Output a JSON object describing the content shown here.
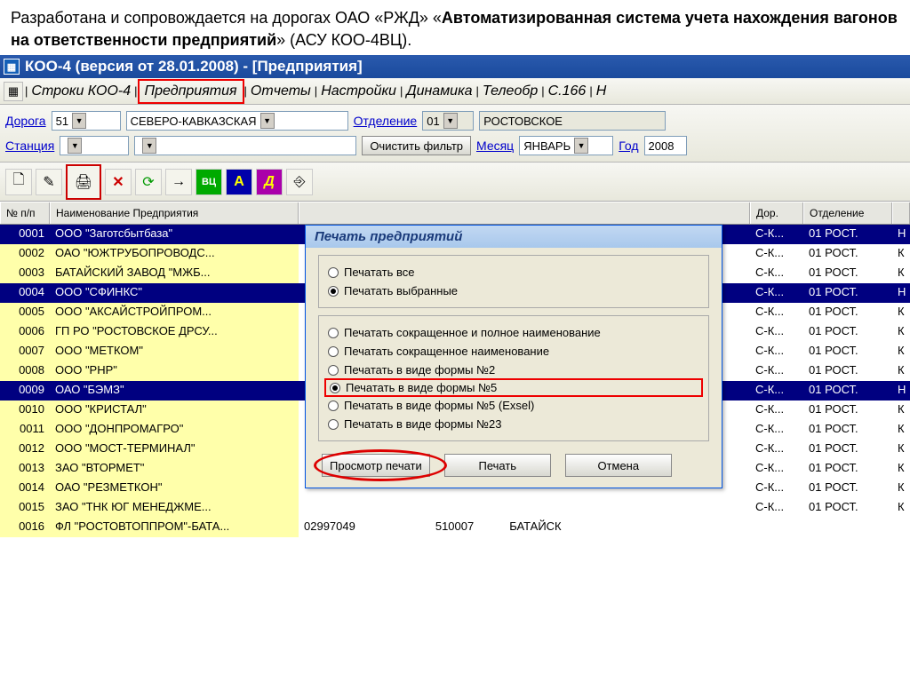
{
  "caption": {
    "pre": "Разработана и сопровождается на дорогах ОАО «РЖД» «",
    "bold": "Автоматизированная система учета нахождения вагонов на ответственности предприятий",
    "post": "» (АСУ КОО-4ВЦ)."
  },
  "window": {
    "title": "КОО-4 (версия от 28.01.2008) - [Предприятия]"
  },
  "menu": {
    "items": [
      "Строки КОО-4",
      "Предприятия",
      "Отчеты",
      "Настройки",
      "Динамика",
      "Телеобр",
      "С.166",
      "Н"
    ]
  },
  "filter": {
    "road_label": "Дорога",
    "road_code": "51",
    "road_name": "СЕВЕРО-КАВКАЗСКАЯ",
    "dept_label": "Отделение",
    "dept_code": "01",
    "dept_name": "РОСТОВСКОЕ",
    "station_label": "Станция",
    "clear_btn": "Очистить фильтр",
    "month_label": "Месяц",
    "month_val": "ЯНВАРЬ",
    "year_label": "Год",
    "year_val": "2008"
  },
  "grid": {
    "headers": {
      "id": "№ п/п",
      "name": "Наименование Предприятия",
      "dor": "Дор.",
      "dep": "Отделение"
    },
    "rows": [
      {
        "id": "0001",
        "name": "ООО \"Заготсбытбаза\"",
        "dor": "С-К...",
        "dep": "01 РОСТ.",
        "sel": true,
        "end": "Н"
      },
      {
        "id": "0002",
        "name": "ОАО \"ЮЖТРУБОПРОВОДС...",
        "dor": "С-К...",
        "dep": "01 РОСТ.",
        "sel": false,
        "end": "К"
      },
      {
        "id": "0003",
        "name": "БАТАЙСКИЙ ЗАВОД \"МЖБ...",
        "dor": "С-К...",
        "dep": "01 РОСТ.",
        "sel": false,
        "end": "К"
      },
      {
        "id": "0004",
        "name": "ООО \"СФИНКС\"",
        "dor": "С-К...",
        "dep": "01 РОСТ.",
        "sel": true,
        "end": "Н"
      },
      {
        "id": "0005",
        "name": "ООО \"АКСАЙСТРОЙПРОМ...",
        "dor": "С-К...",
        "dep": "01 РОСТ.",
        "sel": false,
        "end": "К"
      },
      {
        "id": "0006",
        "name": "ГП РО \"РОСТОВСКОЕ ДРСУ...",
        "dor": "С-К...",
        "dep": "01 РОСТ.",
        "sel": false,
        "end": "К"
      },
      {
        "id": "0007",
        "name": "ООО \"МЕТКОМ\"",
        "dor": "С-К...",
        "dep": "01 РОСТ.",
        "sel": false,
        "end": "К"
      },
      {
        "id": "0008",
        "name": "ООО \"РНР\"",
        "dor": "С-К...",
        "dep": "01 РОСТ.",
        "sel": false,
        "end": "К"
      },
      {
        "id": "0009",
        "name": "ОАО \"БЭМЗ\"",
        "dor": "С-К...",
        "dep": "01 РОСТ.",
        "sel": true,
        "end": "Н"
      },
      {
        "id": "0010",
        "name": "ООО \"КРИСТАЛ\"",
        "dor": "С-К...",
        "dep": "01 РОСТ.",
        "sel": false,
        "end": "К"
      },
      {
        "id": "0011",
        "name": "ООО \"ДОНПРОМАГРО\"",
        "dor": "С-К...",
        "dep": "01 РОСТ.",
        "sel": false,
        "end": "К"
      },
      {
        "id": "0012",
        "name": "ООО \"МОСТ-ТЕРМИНАЛ\"",
        "dor": "С-К...",
        "dep": "01 РОСТ.",
        "sel": false,
        "end": "К"
      },
      {
        "id": "0013",
        "name": "ЗАО \"ВТОРМЕТ\"",
        "dor": "С-К...",
        "dep": "01 РОСТ.",
        "sel": false,
        "end": "К"
      },
      {
        "id": "0014",
        "name": "ОАО \"РЕЗМЕТКОН\"",
        "dor": "С-К...",
        "dep": "01 РОСТ.",
        "sel": false,
        "end": "К"
      },
      {
        "id": "0015",
        "name": "ЗАО \"ТНК ЮГ МЕНЕДЖМЕ...",
        "dor": "С-К...",
        "dep": "01 РОСТ.",
        "sel": false,
        "end": "К"
      },
      {
        "id": "0016",
        "name": "ФЛ \"РОСТОВТОППРОМ\"-БАТА...",
        "mid1": "02997049",
        "mid2": "510007",
        "mid3": "БАТАЙСК",
        "dor": "",
        "dep": "",
        "sel": false,
        "end": ""
      }
    ]
  },
  "dialog": {
    "title": "Печать предприятий",
    "group1": [
      "Печатать все",
      "Печатать выбранные"
    ],
    "group1_sel": 1,
    "group2": [
      "Печатать сокращенное и полное наименование",
      "Печатать сокращенное наименование",
      "Печатать в виде формы №2",
      "Печатать в виде формы №5",
      "Печатать в виде формы №5 (Exsel)",
      "Печатать в виде формы №23"
    ],
    "group2_sel": 3,
    "group2_hl": 3,
    "btns": {
      "preview": "Просмотр печати",
      "print": "Печать",
      "cancel": "Отмена"
    }
  },
  "toolbar": {
    "icons": [
      "new",
      "edit",
      "print",
      "delete",
      "refresh",
      "arrow",
      "box-green",
      "box-a",
      "box-d",
      "exit"
    ]
  }
}
